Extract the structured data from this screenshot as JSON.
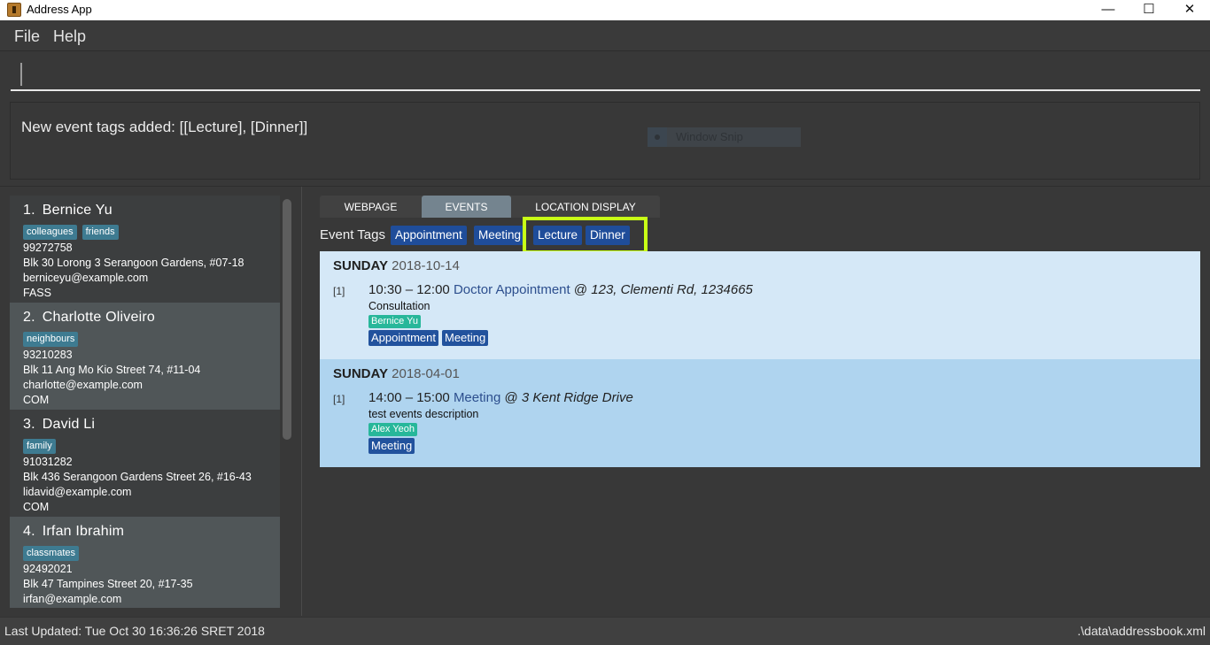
{
  "window": {
    "title": "Address App",
    "minimize_icon": "minimize-icon",
    "maximize_icon": "maximize-icon",
    "close_icon": "close-icon",
    "minimize_glyph": "—",
    "maximize_glyph": "☐",
    "close_glyph": "✕"
  },
  "menu": {
    "items": [
      {
        "label": "File"
      },
      {
        "label": "Help"
      }
    ]
  },
  "command": {
    "value": "",
    "placeholder": ""
  },
  "result": {
    "text": "New event tags added: [[Lecture], [Dinner]]"
  },
  "overlay": {
    "window_snip_label": "Window Snip"
  },
  "persons": [
    {
      "index": "1.",
      "name": "Bernice Yu",
      "tags": [
        "colleagues",
        "friends"
      ],
      "phone": "99272758",
      "address": "Blk 30 Lorong 3 Serangoon Gardens, #07-18",
      "email": "berniceyu@example.com",
      "faculty": "FASS"
    },
    {
      "index": "2.",
      "name": "Charlotte Oliveiro",
      "tags": [
        "neighbours"
      ],
      "phone": "93210283",
      "address": "Blk 11 Ang Mo Kio Street 74, #11-04",
      "email": "charlotte@example.com",
      "faculty": "COM"
    },
    {
      "index": "3.",
      "name": "David Li",
      "tags": [
        "family"
      ],
      "phone": "91031282",
      "address": "Blk 436 Serangoon Gardens Street 26, #16-43",
      "email": "lidavid@example.com",
      "faculty": "COM"
    },
    {
      "index": "4.",
      "name": "Irfan Ibrahim",
      "tags": [
        "classmates"
      ],
      "phone": "92492021",
      "address": "Blk 47 Tampines Street 20, #17-35",
      "email": "irfan@example.com",
      "faculty": ""
    }
  ],
  "tabs": [
    {
      "label": "WEBPAGE",
      "active": false
    },
    {
      "label": "EVENTS",
      "active": true
    },
    {
      "label": "LOCATION DISPLAY",
      "active": false
    }
  ],
  "event_tags": {
    "label": "Event Tags",
    "tags": [
      "Appointment",
      "Meeting",
      "Lecture",
      "Dinner"
    ],
    "highlighted": [
      "Lecture",
      "Dinner"
    ],
    "highlight_color": "#c8ff16"
  },
  "days": [
    {
      "day_name": "SUNDAY",
      "date": "2018-10-14",
      "events": [
        {
          "index": "[1]",
          "time": "10:30 – 12:00",
          "title": "Doctor Appointment",
          "at": "@",
          "location": "123, Clementi Rd, 1234665",
          "description": "Consultation",
          "person": "Bernice Yu",
          "tags": [
            "Appointment",
            "Meeting"
          ]
        }
      ]
    },
    {
      "day_name": "SUNDAY",
      "date": "2018-04-01",
      "events": [
        {
          "index": "[1]",
          "time": "14:00 – 15:00",
          "title": "Meeting",
          "at": "@",
          "location": "3 Kent Ridge Drive",
          "description": "test events description",
          "person": "Alex Yeoh",
          "tags": [
            "Meeting"
          ]
        }
      ]
    }
  ],
  "status": {
    "last_updated": "Last Updated: Tue Oct 30 16:36:26 SRET 2018",
    "file_path": ".\\data\\addressbook.xml"
  },
  "colors": {
    "person_tag": "#3e7b91",
    "event_tag": "#1f4d9a",
    "person_chip": "#27b79a",
    "day_bg_1": "#d5e8f7",
    "day_bg_2": "#afd4ef"
  }
}
